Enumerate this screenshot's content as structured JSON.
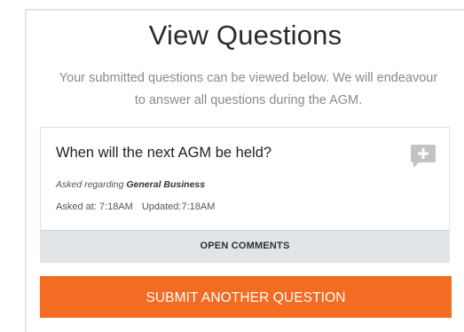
{
  "page": {
    "title": "View Questions",
    "subtitle": "Your submitted questions can be viewed below. We will endeavour to answer all questions during the AGM."
  },
  "question": {
    "text": "When will the next AGM be held?",
    "regarding_prefix": "Asked regarding",
    "regarding_topic": "General Business",
    "asked_at": "Asked at: 7:18AM",
    "updated": "Updated:7:18AM",
    "comment_icon": "add-comment-icon",
    "open_comments_label": "OPEN COMMENTS"
  },
  "actions": {
    "submit_label": "SUBMIT ANOTHER QUESTION"
  },
  "colors": {
    "accent": "#f26c23",
    "comments_bar": "#e2e5e8",
    "icon_gray": "#c3c3c3"
  }
}
